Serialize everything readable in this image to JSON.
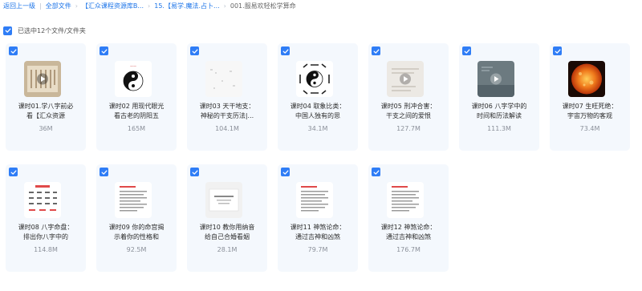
{
  "breadcrumb": {
    "back": "返回上一级",
    "root": "全部文件",
    "level1": "【汇众课程资源库B...",
    "level2": "15.【易学.魔法.占卜...",
    "current": "001.服易欢轻松学算命"
  },
  "selection": {
    "label": "已选中12个文件/文件夹"
  },
  "files": [
    {
      "line1": "课时01.学八字前必",
      "line2": "看【汇众资源",
      "size": "36M",
      "thumb": "video-scroll"
    },
    {
      "line1": "课时02 用现代眼光",
      "line2": "看古老的阴阳五",
      "size": "165M",
      "thumb": "taiji"
    },
    {
      "line1": "课时03 天干地支：",
      "line2": "神秘的干支历法|...",
      "size": "104.1M",
      "thumb": "blank-doc"
    },
    {
      "line1": "课时04 取象比类：",
      "line2": "中国人独有的思",
      "size": "34.1M",
      "thumb": "bagua"
    },
    {
      "line1": "课时05 刑冲合害：",
      "line2": "干支之间的爱恨",
      "size": "127.7M",
      "thumb": "video-light"
    },
    {
      "line1": "课时06 八字学中的",
      "line2": "时间和历法解读",
      "size": "111.3M",
      "thumb": "video-gray"
    },
    {
      "line1": "课时07 生旺死绝：",
      "line2": "宇宙万物的客观",
      "size": "73.4M",
      "thumb": "sun"
    },
    {
      "line1": "课时08 八字命盘：",
      "line2": "排出你八字中的",
      "size": "114.8M",
      "thumb": "chart-doc"
    },
    {
      "line1": "课时09 你的命宫揭",
      "line2": "示着你的性格和",
      "size": "92.5M",
      "thumb": "text-doc"
    },
    {
      "line1": "课时10 教你用纳音",
      "line2": "给自己合婚看姻",
      "size": "28.1M",
      "thumb": "slide-doc"
    },
    {
      "line1": "课时11 神煞论命：",
      "line2": "通过吉神和凶煞",
      "size": "79.7M",
      "thumb": "text-doc"
    },
    {
      "line1": "课时12 神煞论命：",
      "line2": "通过吉神和凶煞",
      "size": "176.7M",
      "thumb": "text-doc"
    }
  ],
  "colors": {
    "accent": "#2f7df6",
    "card_bg": "#f4f8fd",
    "link": "#1a73e8"
  }
}
